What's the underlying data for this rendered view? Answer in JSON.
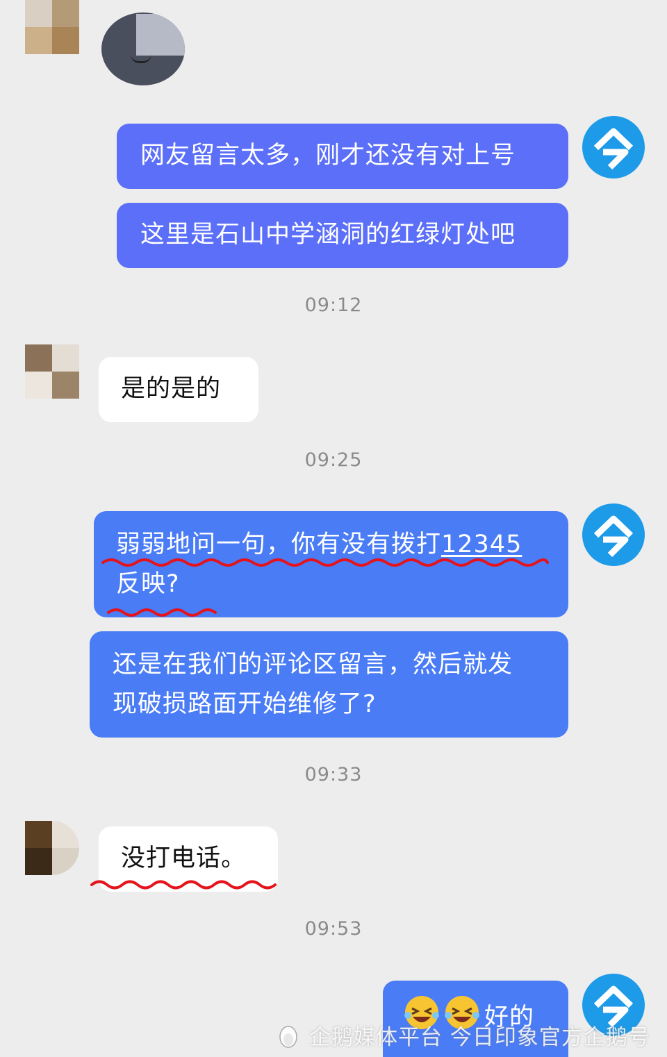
{
  "messages": [
    {
      "id": "m1",
      "text": "网友留言太多，刚才还没有对上号"
    },
    {
      "id": "m2",
      "text": "这里是石山中学涵洞的红绿灯处吧"
    },
    {
      "id": "t1",
      "text": "09:12"
    },
    {
      "id": "m3",
      "text": "是的是的"
    },
    {
      "id": "t2",
      "text": "09:25"
    },
    {
      "id": "m4",
      "line1_prefix": "弱弱地问一句，你有没有拨打",
      "line1_link": "12345",
      "line2": "反映?"
    },
    {
      "id": "m5",
      "line1": "还是在我们的评论区留言，然后就发",
      "line2": "现破损路面开始维修了?"
    },
    {
      "id": "t3",
      "text": "09:33"
    },
    {
      "id": "m6",
      "text": "没打电话。"
    },
    {
      "id": "t4",
      "text": "09:53"
    },
    {
      "id": "m7",
      "text": "好的",
      "emoji": "laughing-face-icon"
    }
  ],
  "watermark": {
    "text": "企鹅媒体平台 今日印象官方企鹅号"
  },
  "colors": {
    "background": "#ededed",
    "outgoing_bubble": "#5b6ff8",
    "outgoing_bubble_alt": "#4a7cf6",
    "incoming_bubble": "#ffffff",
    "brand_avatar": "#1d9ae8",
    "annotation": "#e4131c"
  }
}
